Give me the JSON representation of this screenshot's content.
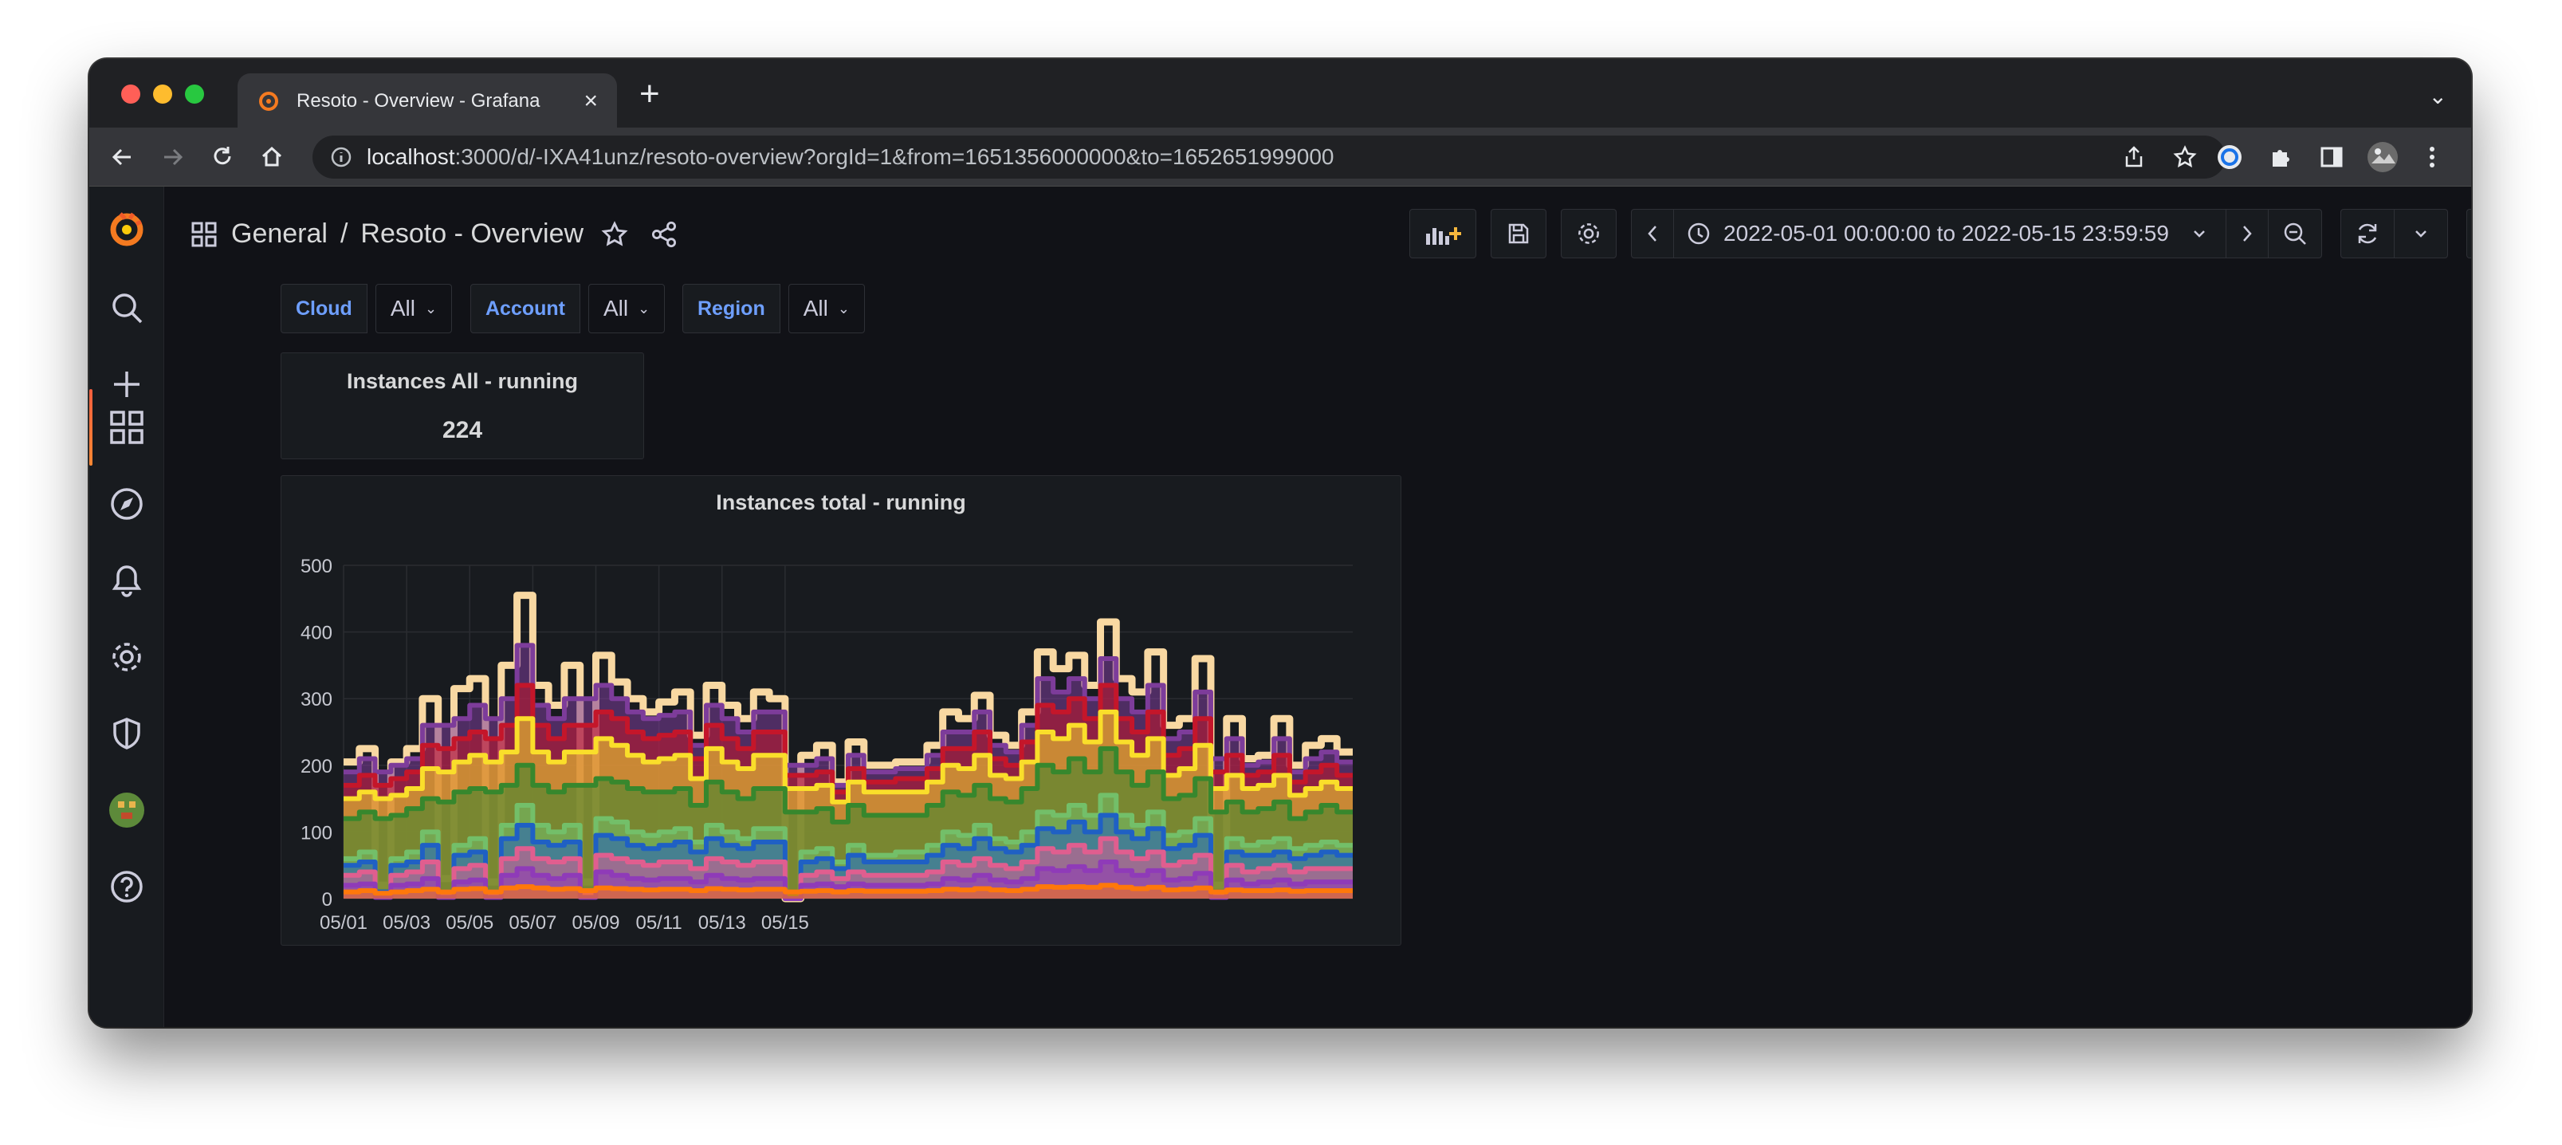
{
  "browser": {
    "tab_title": "Resoto - Overview - Grafana",
    "url_host": "localhost",
    "url_rest": ":3000/d/-IXA41unz/resoto-overview?orgId=1&from=1651356000000&to=1652651999000"
  },
  "sidebar": {
    "items": [
      {
        "icon": "grafana-logo-icon"
      },
      {
        "icon": "search-icon"
      },
      {
        "icon": "plus-icon"
      },
      {
        "icon": "dashboards-icon",
        "active": true
      },
      {
        "icon": "explore-compass-icon"
      },
      {
        "icon": "alerting-bell-icon"
      },
      {
        "icon": "gear-icon"
      },
      {
        "icon": "shield-icon"
      },
      {
        "icon": "avatar"
      },
      {
        "icon": "help-icon"
      }
    ]
  },
  "dashboard": {
    "folder": "General",
    "separator": "/",
    "title": "Resoto - Overview",
    "time_range": "2022-05-01 00:00:00 to 2022-05-15 23:59:59"
  },
  "variables": [
    {
      "label": "Cloud",
      "value": "All"
    },
    {
      "label": "Account",
      "value": "All"
    },
    {
      "label": "Region",
      "value": "All"
    }
  ],
  "stat_panel": {
    "title": "Instances All - running",
    "value": "224"
  },
  "chart_panel": {
    "title": "Instances total - running"
  },
  "colors": {
    "accent": "#f55f3e",
    "variable_label": "#6e9fff",
    "background": "#111217",
    "panel": "#181b1f"
  },
  "chart_data": {
    "type": "area",
    "stacked": true,
    "title": "Instances total - running",
    "xlabel": "",
    "ylabel": "",
    "ylim": [
      0,
      500
    ],
    "yticks": [
      0,
      100,
      200,
      300,
      400,
      500
    ],
    "xticks": [
      "05/01",
      "05/03",
      "05/05",
      "05/07",
      "05/09",
      "05/11",
      "05/13",
      "05/15"
    ],
    "x_start": "05/01",
    "x_end": "05/16",
    "x_step_hours": 12,
    "grid": true,
    "legend": "none",
    "total_series": [
      205,
      225,
      20,
      205,
      225,
      300,
      30,
      315,
      330,
      25,
      350,
      455,
      320,
      290,
      350,
      25,
      365,
      325,
      300,
      280,
      295,
      310,
      245,
      320,
      290,
      270,
      310,
      300,
      0,
      215,
      230,
      175,
      235,
      200,
      200,
      205,
      205,
      230,
      280,
      270,
      305,
      245,
      230,
      280,
      370,
      345,
      365,
      320,
      415,
      330,
      310,
      370,
      260,
      270,
      360,
      20,
      270,
      210,
      215,
      270,
      200,
      230,
      240,
      220
    ],
    "series": [
      {
        "color": "#f8d8a2",
        "values": [
          205,
          225,
          20,
          205,
          225,
          300,
          30,
          315,
          330,
          25,
          350,
          455,
          320,
          290,
          350,
          25,
          365,
          325,
          300,
          280,
          295,
          310,
          245,
          320,
          290,
          270,
          310,
          300,
          0,
          215,
          230,
          175,
          235,
          200,
          200,
          205,
          205,
          230,
          280,
          270,
          305,
          245,
          230,
          280,
          370,
          345,
          365,
          320,
          415,
          330,
          310,
          370,
          260,
          270,
          360,
          20,
          270,
          210,
          215,
          270,
          200,
          230,
          240,
          220
        ]
      },
      {
        "color": "#7d3c9a",
        "values": [
          190,
          210,
          190,
          200,
          210,
          260,
          260,
          270,
          290,
          270,
          300,
          380,
          290,
          270,
          300,
          300,
          320,
          300,
          280,
          270,
          275,
          280,
          230,
          290,
          270,
          250,
          280,
          280,
          200,
          200,
          210,
          170,
          215,
          190,
          190,
          195,
          195,
          215,
          250,
          250,
          280,
          230,
          220,
          260,
          330,
          310,
          330,
          300,
          360,
          300,
          280,
          320,
          240,
          250,
          310,
          210,
          240,
          200,
          205,
          240,
          190,
          210,
          220,
          205
        ]
      },
      {
        "color": "#c4162a",
        "values": [
          170,
          185,
          170,
          180,
          190,
          230,
          225,
          240,
          250,
          240,
          260,
          320,
          260,
          240,
          260,
          260,
          280,
          270,
          250,
          240,
          245,
          250,
          210,
          260,
          240,
          225,
          250,
          250,
          185,
          185,
          190,
          160,
          195,
          175,
          175,
          180,
          180,
          195,
          225,
          225,
          250,
          210,
          200,
          235,
          290,
          280,
          300,
          270,
          320,
          270,
          250,
          280,
          215,
          225,
          270,
          190,
          215,
          185,
          190,
          215,
          175,
          190,
          200,
          185
        ]
      },
      {
        "color": "#fade2a",
        "values": [
          150,
          160,
          150,
          155,
          165,
          195,
          190,
          205,
          215,
          205,
          220,
          270,
          220,
          205,
          220,
          220,
          240,
          230,
          215,
          205,
          210,
          215,
          180,
          225,
          205,
          195,
          215,
          215,
          165,
          165,
          170,
          145,
          175,
          160,
          160,
          160,
          160,
          175,
          200,
          195,
          215,
          185,
          180,
          205,
          250,
          240,
          260,
          235,
          280,
          235,
          215,
          240,
          185,
          195,
          230,
          165,
          185,
          165,
          170,
          185,
          155,
          165,
          175,
          165
        ]
      },
      {
        "color": "#37872d",
        "values": [
          120,
          130,
          120,
          125,
          135,
          150,
          145,
          160,
          165,
          160,
          170,
          200,
          170,
          160,
          170,
          170,
          180,
          175,
          165,
          160,
          160,
          165,
          140,
          175,
          160,
          150,
          165,
          165,
          130,
          130,
          135,
          115,
          140,
          125,
          125,
          125,
          125,
          140,
          160,
          155,
          170,
          150,
          145,
          165,
          200,
          190,
          210,
          190,
          225,
          190,
          170,
          190,
          150,
          155,
          180,
          130,
          145,
          130,
          135,
          145,
          120,
          130,
          140,
          130
        ]
      },
      {
        "color": "#73bf69",
        "values": [
          60,
          70,
          10,
          60,
          70,
          100,
          10,
          80,
          90,
          10,
          110,
          140,
          110,
          100,
          110,
          10,
          120,
          115,
          100,
          95,
          100,
          105,
          85,
          110,
          100,
          90,
          105,
          105,
          0,
          70,
          75,
          55,
          80,
          65,
          65,
          70,
          70,
          80,
          100,
          95,
          110,
          90,
          85,
          100,
          130,
          125,
          140,
          125,
          155,
          125,
          110,
          130,
          95,
          100,
          120,
          10,
          90,
          80,
          85,
          90,
          75,
          80,
          85,
          80
        ]
      },
      {
        "color": "#1f60c4",
        "values": [
          50,
          55,
          10,
          50,
          55,
          80,
          10,
          65,
          70,
          10,
          90,
          110,
          85,
          80,
          85,
          10,
          95,
          90,
          80,
          75,
          80,
          85,
          70,
          90,
          80,
          75,
          85,
          85,
          0,
          55,
          60,
          45,
          65,
          55,
          55,
          55,
          55,
          65,
          80,
          75,
          90,
          75,
          70,
          80,
          105,
          100,
          115,
          100,
          125,
          100,
          90,
          105,
          75,
          80,
          95,
          10,
          70,
          65,
          65,
          70,
          60,
          65,
          70,
          65
        ]
      },
      {
        "color": "#e05e8f",
        "values": [
          35,
          40,
          5,
          35,
          40,
          55,
          5,
          45,
          50,
          5,
          60,
          75,
          60,
          55,
          60,
          5,
          65,
          60,
          55,
          50,
          55,
          55,
          45,
          60,
          55,
          50,
          55,
          55,
          0,
          35,
          40,
          30,
          40,
          35,
          35,
          35,
          35,
          40,
          55,
          50,
          60,
          50,
          45,
          55,
          75,
          70,
          80,
          70,
          90,
          70,
          60,
          70,
          50,
          55,
          65,
          5,
          50,
          40,
          45,
          50,
          40,
          45,
          45,
          45
        ]
      },
      {
        "color": "#8f3bb8",
        "values": [
          20,
          22,
          2,
          20,
          22,
          30,
          2,
          25,
          28,
          2,
          35,
          45,
          35,
          30,
          35,
          2,
          40,
          35,
          30,
          28,
          30,
          30,
          25,
          35,
          30,
          28,
          30,
          30,
          0,
          20,
          22,
          18,
          22,
          20,
          20,
          20,
          20,
          22,
          30,
          28,
          35,
          28,
          25,
          30,
          45,
          42,
          48,
          42,
          55,
          42,
          35,
          42,
          28,
          30,
          38,
          2,
          28,
          22,
          25,
          28,
          22,
          25,
          25,
          25
        ]
      },
      {
        "color": "#ff780a",
        "values": [
          10,
          12,
          8,
          10,
          12,
          14,
          10,
          14,
          15,
          10,
          16,
          18,
          16,
          14,
          15,
          12,
          16,
          15,
          14,
          13,
          14,
          14,
          12,
          15,
          14,
          13,
          14,
          14,
          10,
          11,
          12,
          10,
          12,
          11,
          11,
          11,
          11,
          12,
          14,
          13,
          15,
          13,
          12,
          14,
          18,
          17,
          18,
          17,
          20,
          17,
          15,
          17,
          13,
          14,
          16,
          10,
          13,
          12,
          12,
          13,
          11,
          12,
          12,
          12
        ]
      }
    ]
  }
}
